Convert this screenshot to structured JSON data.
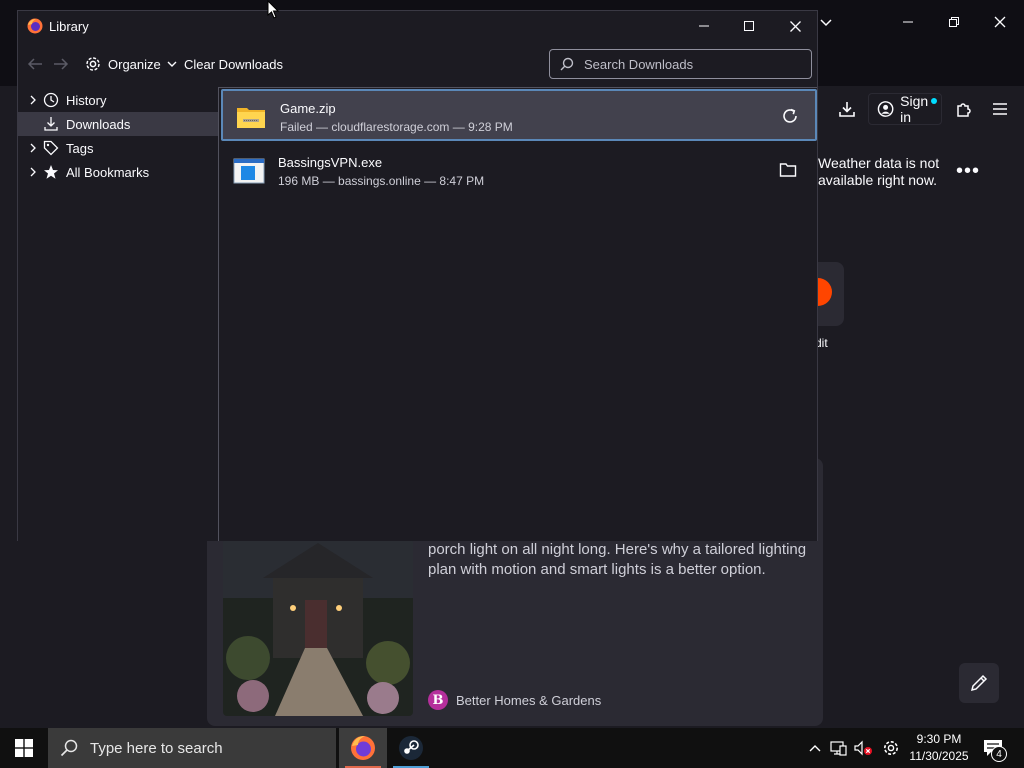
{
  "colors": {
    "background": "#1c1b22",
    "panel": "#2b2a33",
    "selected_row": "#42414d",
    "selection_border": "#5b88b8",
    "accent_firefox": "#ff7139",
    "taskbar": "#101010"
  },
  "browser": {
    "toolbar": {
      "sign_in_label": "Sign in",
      "icons": [
        "downloads-icon",
        "account-icon",
        "extensions-icon",
        "menu-icon"
      ]
    },
    "newtab": {
      "weather_message": "Weather data is not available right now.",
      "shortcut_label": "dit",
      "story": {
        "text": "porch light on all night long. Here's why a tailored lighting plan with motion and smart lights is a better option.",
        "source": "Better Homes & Gardens",
        "source_initial": "B"
      }
    }
  },
  "library": {
    "title": "Library",
    "toolbar": {
      "organize_label": "Organize",
      "clear_downloads_label": "Clear Downloads",
      "search_placeholder": "Search Downloads"
    },
    "sidebar": [
      {
        "label": "History",
        "icon": "clock-icon",
        "expandable": true,
        "selected": false
      },
      {
        "label": "Downloads",
        "icon": "download-icon",
        "expandable": false,
        "selected": true
      },
      {
        "label": "Tags",
        "icon": "tag-icon",
        "expandable": true,
        "selected": false
      },
      {
        "label": "All Bookmarks",
        "icon": "star-icon",
        "expandable": true,
        "selected": false
      }
    ],
    "downloads": [
      {
        "name": "Game.zip",
        "status": "Failed — cloudflarestorage.com — 9:28 PM",
        "icon": "zip-folder-icon",
        "action": "retry-icon",
        "selected": true
      },
      {
        "name": "BassingsVPN.exe",
        "status": "196 MB — bassings.online — 8:47 PM",
        "icon": "exe-window-icon",
        "action": "show-in-folder-icon",
        "selected": false
      }
    ]
  },
  "taskbar": {
    "search_placeholder": "Type here to search",
    "apps": [
      "firefox-icon",
      "steam-icon"
    ],
    "clock_time": "9:30 PM",
    "clock_date": "11/30/2025",
    "notification_count": "4"
  }
}
